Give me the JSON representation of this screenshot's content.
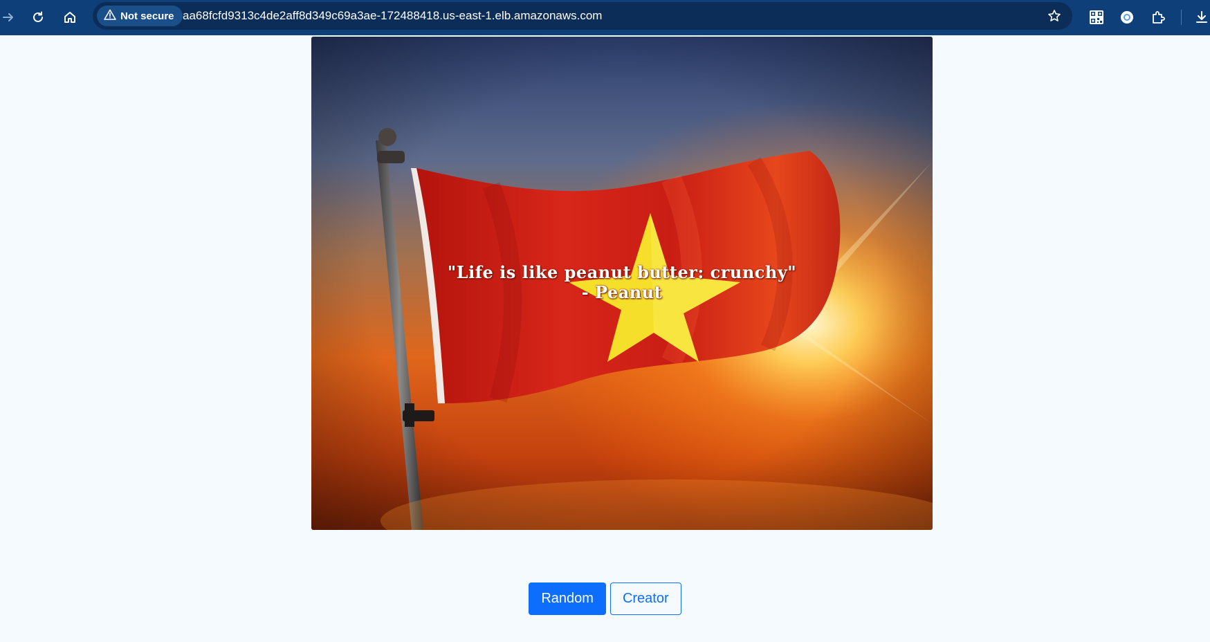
{
  "browser": {
    "security_label": "Not secure",
    "url": "aa68fcfd9313c4de2aff8d349c69a3ae-172488418.us-east-1.elb.amazonaws.com",
    "icons": [
      "forward-arrow-icon",
      "reload-icon",
      "home-icon",
      "warning-icon",
      "bookmark-star-icon",
      "qr-code-icon",
      "extension-circle-icon",
      "puzzle-icon",
      "download-icon"
    ]
  },
  "hero": {
    "quote_line1": "\"Life is like peanut butter: crunchy\"",
    "quote_line2": "- Peanut"
  },
  "buttons": {
    "random_label": "Random",
    "creator_label": "Creator"
  },
  "colors": {
    "toolbar": "#0e3f78",
    "page_bg": "#f4fafd",
    "primary": "#0d6efd",
    "flag_red": "#d21f14",
    "star_yellow": "#f6df2a"
  }
}
